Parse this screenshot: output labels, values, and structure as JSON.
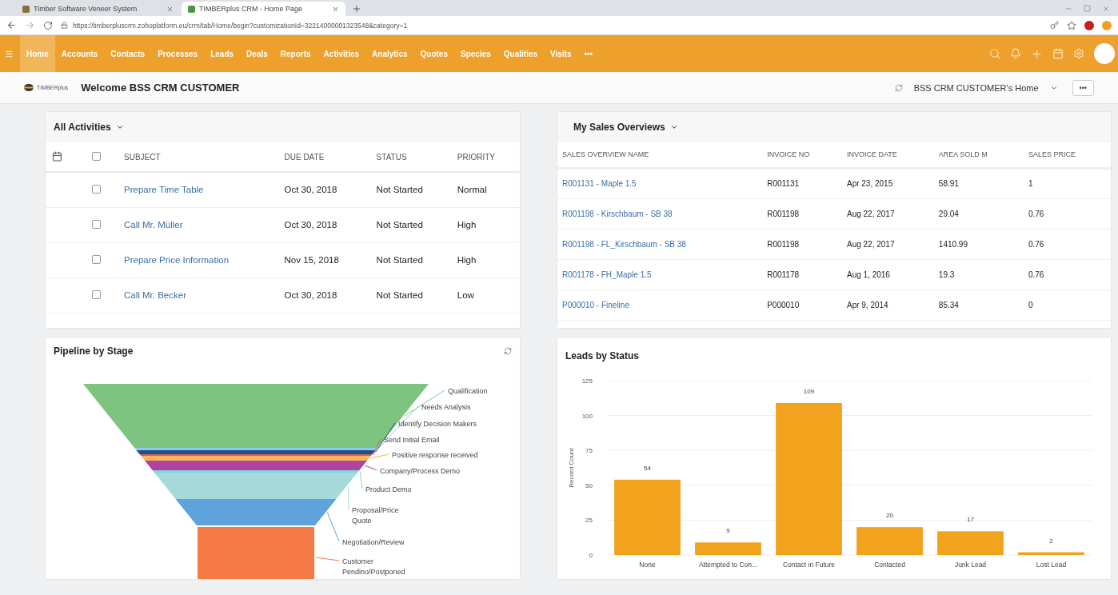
{
  "browser": {
    "tabs": [
      {
        "title": "Timber Software Veneer System",
        "selected": false
      },
      {
        "title": "TIMBERplus CRM - Home Page",
        "selected": true
      }
    ],
    "url": "https://timberpluscrm.zohoplatform.eu/crm/tab/Home/begin?customizationId=32214000001323548&category=1"
  },
  "nav": {
    "items": [
      {
        "label": "Home",
        "selected": true
      },
      {
        "label": "Accounts",
        "selected": false
      },
      {
        "label": "Contacts",
        "selected": false
      },
      {
        "label": "Processes",
        "selected": false
      },
      {
        "label": "Leads",
        "selected": false
      },
      {
        "label": "Deals",
        "selected": false
      },
      {
        "label": "Reports",
        "selected": false
      },
      {
        "label": "Activities",
        "selected": false
      },
      {
        "label": "Analytics",
        "selected": false
      },
      {
        "label": "Quotes",
        "selected": false
      },
      {
        "label": "Species",
        "selected": false
      },
      {
        "label": "Qualities",
        "selected": false
      },
      {
        "label": "Visits",
        "selected": false
      }
    ],
    "more": "•••"
  },
  "header": {
    "logo": "TIMBERplus",
    "welcome": "Welcome BSS CRM CUSTOMER",
    "home_selector": "BSS CRM CUSTOMER's Home",
    "more_button": "•••"
  },
  "activities": {
    "title": "All Activities",
    "all_checked": false,
    "columns": [
      "SUBJECT",
      "DUE DATE",
      "STATUS",
      "PRIORITY"
    ],
    "rows": [
      {
        "subject": "Prepare Time Table",
        "due_date": "Oct 30, 2018",
        "status": "Not Started",
        "priority": "Normal",
        "checked": false
      },
      {
        "subject": "Call Mr. Müller",
        "due_date": "Oct 30, 2018",
        "status": "Not Started",
        "priority": "High",
        "checked": false
      },
      {
        "subject": "Prepare Price Information",
        "due_date": "Nov 15, 2018",
        "status": "Not Started",
        "priority": "High",
        "checked": false
      },
      {
        "subject": "Call Mr. Becker",
        "due_date": "Oct 30, 2018",
        "status": "Not Started",
        "priority": "Low",
        "checked": false
      }
    ]
  },
  "sales": {
    "title": "My Sales Overviews",
    "columns": [
      "SALES OVERVIEW NAME",
      "INVOICE NO",
      "INVOICE DATE",
      "AREA SOLD M",
      "SALES PRICE"
    ],
    "rows": [
      [
        "R001131 - Maple 1.5",
        "R001131",
        "Apr 23, 2015",
        "58.91",
        "1"
      ],
      [
        "R001198 - Kirschbaum - SB 38",
        "R001198",
        "Aug 22, 2017",
        "29.04",
        "0.76"
      ],
      [
        "R001198 - FL_Kirschbaum - SB 38",
        "R001198",
        "Aug 22, 2017",
        "1410.99",
        "0.76"
      ],
      [
        "R001178 - FH_Maple 1.5",
        "R001178",
        "Aug 1, 2016",
        "19.3",
        "0.76"
      ],
      [
        "P000010 - Fineline",
        "P000010",
        "Apr 9, 2014",
        "85.34",
        "0"
      ]
    ]
  },
  "pipeline": {
    "title": "Pipeline by Stage",
    "stages": [
      {
        "label": "Qualification",
        "color": "#7cc47f"
      },
      {
        "label": "Needs Analysis",
        "color": "#8fcbe8"
      },
      {
        "label": "Identify Decision Makers",
        "color": "#1d4f91"
      },
      {
        "label": "Send Initial Email",
        "color": "#e85a50"
      },
      {
        "label": "Positive response received",
        "color": "#f8b45e"
      },
      {
        "label": "Company/Process Demo",
        "color": "#b0439e"
      },
      {
        "label": "Product Demo",
        "color": "#7fd6de"
      },
      {
        "label": "Proposal/Price Quote",
        "color": "#a6dada"
      },
      {
        "label": "Negotiation/Review",
        "color": "#5ea3dc"
      },
      {
        "label": "Customer Pendino/Postponed",
        "color": "#f47b45"
      }
    ]
  },
  "leads": {
    "title": "Leads by Status",
    "chart_data": {
      "type": "bar",
      "ylabel": "Record Count",
      "categories": [
        "None",
        "Attempted to Con...",
        "Contact in Future",
        "Contacted",
        "Junk Lead",
        "Lost Lead"
      ],
      "series": [
        {
          "color": "#f2a31d",
          "values": [
            54,
            9,
            109,
            20,
            17,
            2
          ]
        }
      ],
      "grid": true,
      "ylim": [
        0,
        125
      ],
      "yticks": [
        0,
        25,
        50,
        75,
        100,
        125
      ],
      "data_labels": true
    }
  }
}
